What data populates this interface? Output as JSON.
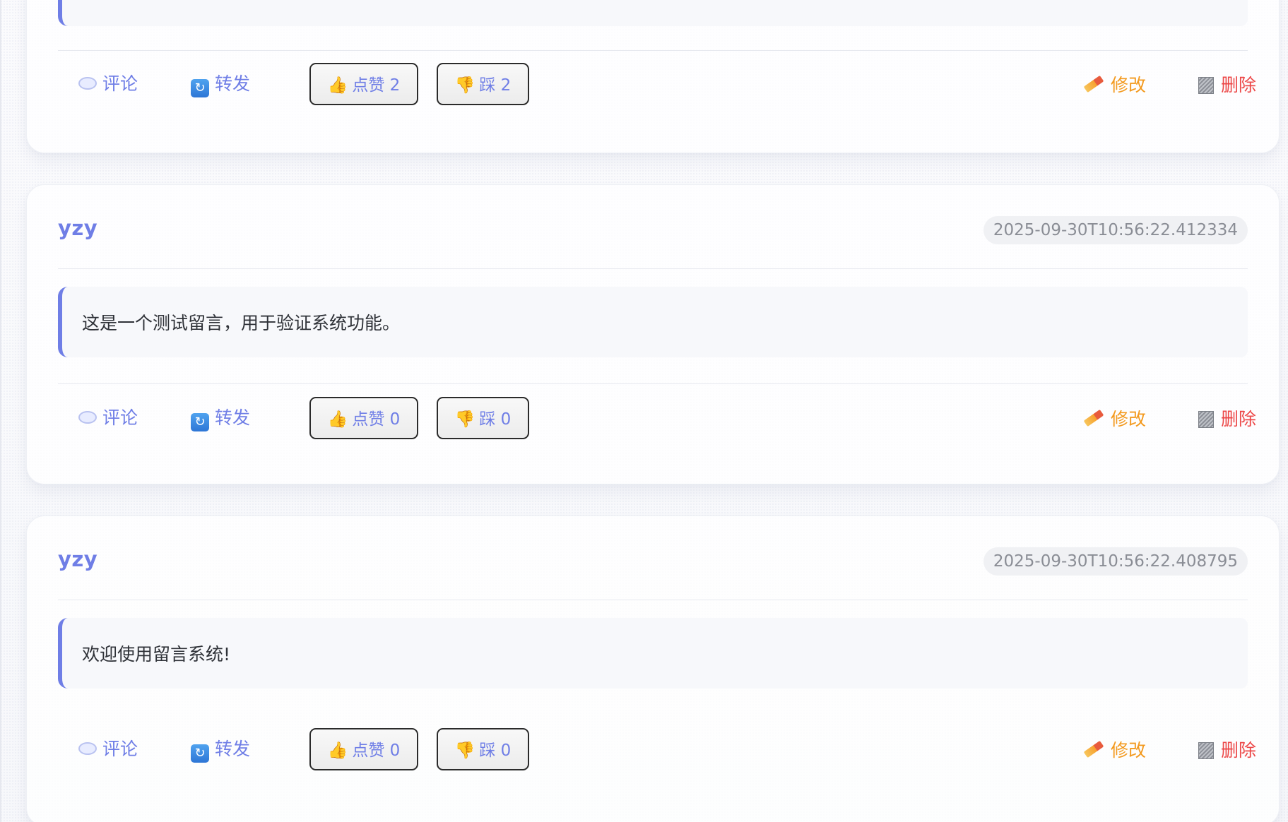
{
  "posts": [
    {
      "author": "",
      "timestamp": "",
      "content": "",
      "actions": {
        "comment": "评论",
        "forward": "转发",
        "like_label": "点赞",
        "like_count": "2",
        "dislike_label": "踩",
        "dislike_count": "2",
        "edit": "修改",
        "delete": "删除"
      }
    },
    {
      "author": "yzy",
      "timestamp": "2025-09-30T10:56:22.412334",
      "content": "这是一个测试留言，用于验证系统功能。",
      "actions": {
        "comment": "评论",
        "forward": "转发",
        "like_label": "点赞",
        "like_count": "0",
        "dislike_label": "踩",
        "dislike_count": "0",
        "edit": "修改",
        "delete": "删除"
      }
    },
    {
      "author": "yzy",
      "timestamp": "2025-09-30T10:56:22.408795",
      "content": "欢迎使用留言系统!",
      "actions": {
        "comment": "评论",
        "forward": "转发",
        "like_label": "点赞",
        "like_count": "0",
        "dislike_label": "踩",
        "dislike_count": "0",
        "edit": "修改",
        "delete": "删除"
      }
    }
  ],
  "icons": {
    "comment": "speech-bubble",
    "forward": "repeat",
    "like": "thumbs-up",
    "dislike": "thumbs-down",
    "edit": "pencil",
    "delete": "wastebasket"
  },
  "colors": {
    "accent": "#6f7ee6",
    "edit": "#f39a1f",
    "delete": "#ec4747"
  }
}
